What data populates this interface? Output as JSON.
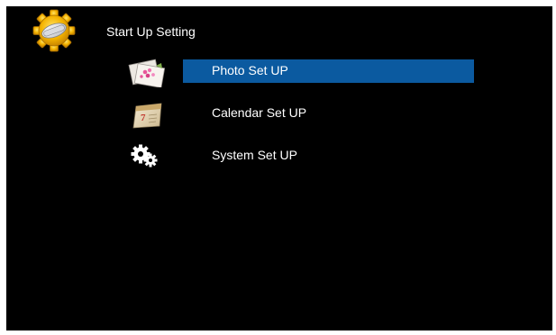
{
  "header": {
    "title": "Start Up Setting",
    "icon": "gear-icon"
  },
  "menu": {
    "selected_index": 0,
    "selection_color": "#0b5aa0",
    "items": [
      {
        "label": "Photo Set UP",
        "icon": "photos-icon",
        "selected": true
      },
      {
        "label": "Calendar Set UP",
        "icon": "calendar-icon",
        "selected": false
      },
      {
        "label": "System Set UP",
        "icon": "gears-icon",
        "selected": false
      }
    ]
  }
}
